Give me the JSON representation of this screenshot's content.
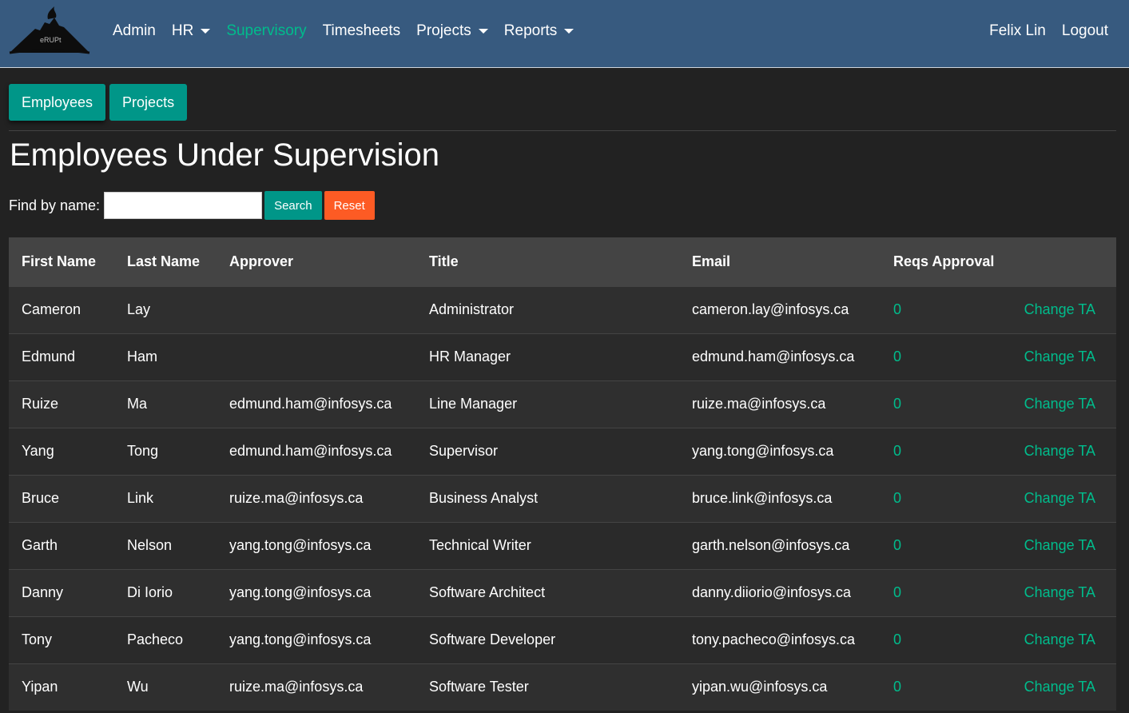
{
  "brand": {
    "logo_text": "eRUPt"
  },
  "nav": {
    "items": [
      {
        "label": "Admin",
        "dropdown": false,
        "active": false
      },
      {
        "label": "HR",
        "dropdown": true,
        "active": false
      },
      {
        "label": "Supervisory",
        "dropdown": false,
        "active": true
      },
      {
        "label": "Timesheets",
        "dropdown": false,
        "active": false
      },
      {
        "label": "Projects",
        "dropdown": true,
        "active": false
      },
      {
        "label": "Reports",
        "dropdown": true,
        "active": false
      }
    ],
    "user_name": "Felix Lin",
    "logout_label": "Logout"
  },
  "subnav": {
    "employees_label": "Employees",
    "projects_label": "Projects",
    "active": "Employees"
  },
  "page": {
    "title": "Employees Under Supervision"
  },
  "search": {
    "label": "Find by name:",
    "value": "",
    "search_label": "Search",
    "reset_label": "Reset"
  },
  "table": {
    "headers": [
      "First Name",
      "Last Name",
      "Approver",
      "Title",
      "Email",
      "Reqs Approval",
      ""
    ],
    "action_label": "Change TA",
    "rows": [
      {
        "first": "Cameron",
        "last": "Lay",
        "approver": "",
        "title": "Administrator",
        "email": "cameron.lay@infosys.ca",
        "reqs": "0"
      },
      {
        "first": "Edmund",
        "last": "Ham",
        "approver": "",
        "title": "HR Manager",
        "email": "edmund.ham@infosys.ca",
        "reqs": "0"
      },
      {
        "first": "Ruize",
        "last": "Ma",
        "approver": "edmund.ham@infosys.ca",
        "title": "Line Manager",
        "email": "ruize.ma@infosys.ca",
        "reqs": "0"
      },
      {
        "first": "Yang",
        "last": "Tong",
        "approver": "edmund.ham@infosys.ca",
        "title": "Supervisor",
        "email": "yang.tong@infosys.ca",
        "reqs": "0"
      },
      {
        "first": "Bruce",
        "last": "Link",
        "approver": "ruize.ma@infosys.ca",
        "title": "Business Analyst",
        "email": "bruce.link@infosys.ca",
        "reqs": "0"
      },
      {
        "first": "Garth",
        "last": "Nelson",
        "approver": "yang.tong@infosys.ca",
        "title": "Technical Writer",
        "email": "garth.nelson@infosys.ca",
        "reqs": "0"
      },
      {
        "first": "Danny",
        "last": "Di Iorio",
        "approver": "yang.tong@infosys.ca",
        "title": "Software Architect",
        "email": "danny.diiorio@infosys.ca",
        "reqs": "0"
      },
      {
        "first": "Tony",
        "last": "Pacheco",
        "approver": "yang.tong@infosys.ca",
        "title": "Software Developer",
        "email": "tony.pacheco@infosys.ca",
        "reqs": "0"
      },
      {
        "first": "Yipan",
        "last": "Wu",
        "approver": "ruize.ma@infosys.ca",
        "title": "Software Tester",
        "email": "yipan.wu@infosys.ca",
        "reqs": "0"
      }
    ]
  },
  "colors": {
    "navbar": "#375a7f",
    "accent": "#00bc8c",
    "teal_button": "#009688",
    "reset_button": "#fd5b24",
    "background": "#222222"
  }
}
